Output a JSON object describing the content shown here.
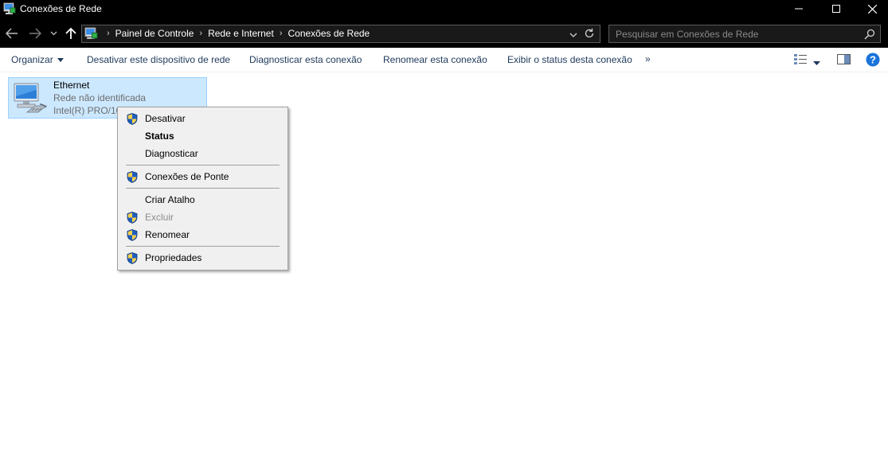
{
  "window": {
    "title": "Conexões de Rede"
  },
  "address": {
    "crumbs": [
      "Painel de Controle",
      "Rede e Internet",
      "Conexões de Rede"
    ],
    "search_placeholder": "Pesquisar em Conexões de Rede"
  },
  "toolbar": {
    "organize": "Organizar",
    "disable_device": "Desativar este dispositivo de rede",
    "diagnose": "Diagnosticar esta conexão",
    "rename": "Renomear esta conexão",
    "view_status": "Exibir o status desta conexão",
    "more": "»"
  },
  "connection": {
    "name": "Ethernet",
    "status": "Rede não identificada",
    "adapter": "Intel(R) PRO/10"
  },
  "context_menu": {
    "items": [
      {
        "label": "Desativar",
        "shield": true,
        "bold": false,
        "disabled": false
      },
      {
        "label": "Status",
        "shield": false,
        "bold": true,
        "disabled": false
      },
      {
        "label": "Diagnosticar",
        "shield": false,
        "bold": false,
        "disabled": false
      },
      {
        "label": "Conexões de Ponte",
        "shield": true,
        "bold": false,
        "disabled": false
      },
      {
        "label": "Criar Atalho",
        "shield": false,
        "bold": false,
        "disabled": false
      },
      {
        "label": "Excluir",
        "shield": true,
        "bold": false,
        "disabled": true
      },
      {
        "label": "Renomear",
        "shield": true,
        "bold": false,
        "disabled": false
      },
      {
        "label": "Propriedades",
        "shield": true,
        "bold": false,
        "disabled": false
      }
    ]
  },
  "icons": {
    "app": "network-connections-icon",
    "minimize": "minimize-icon",
    "maximize": "maximize-icon",
    "close": "close-icon",
    "back": "arrow-left-icon",
    "forward": "arrow-right-icon",
    "recent": "chevron-down-icon",
    "up": "arrow-up-icon",
    "refresh": "refresh-icon",
    "search": "search-icon",
    "shield": "uac-shield-icon",
    "help": "help-icon"
  },
  "colors": {
    "titlebar": "#000000",
    "selection": "#cce8ff",
    "selection_border": "#99d1ff",
    "command_text": "#1e395b",
    "menu_bg": "#f0f0f0"
  }
}
